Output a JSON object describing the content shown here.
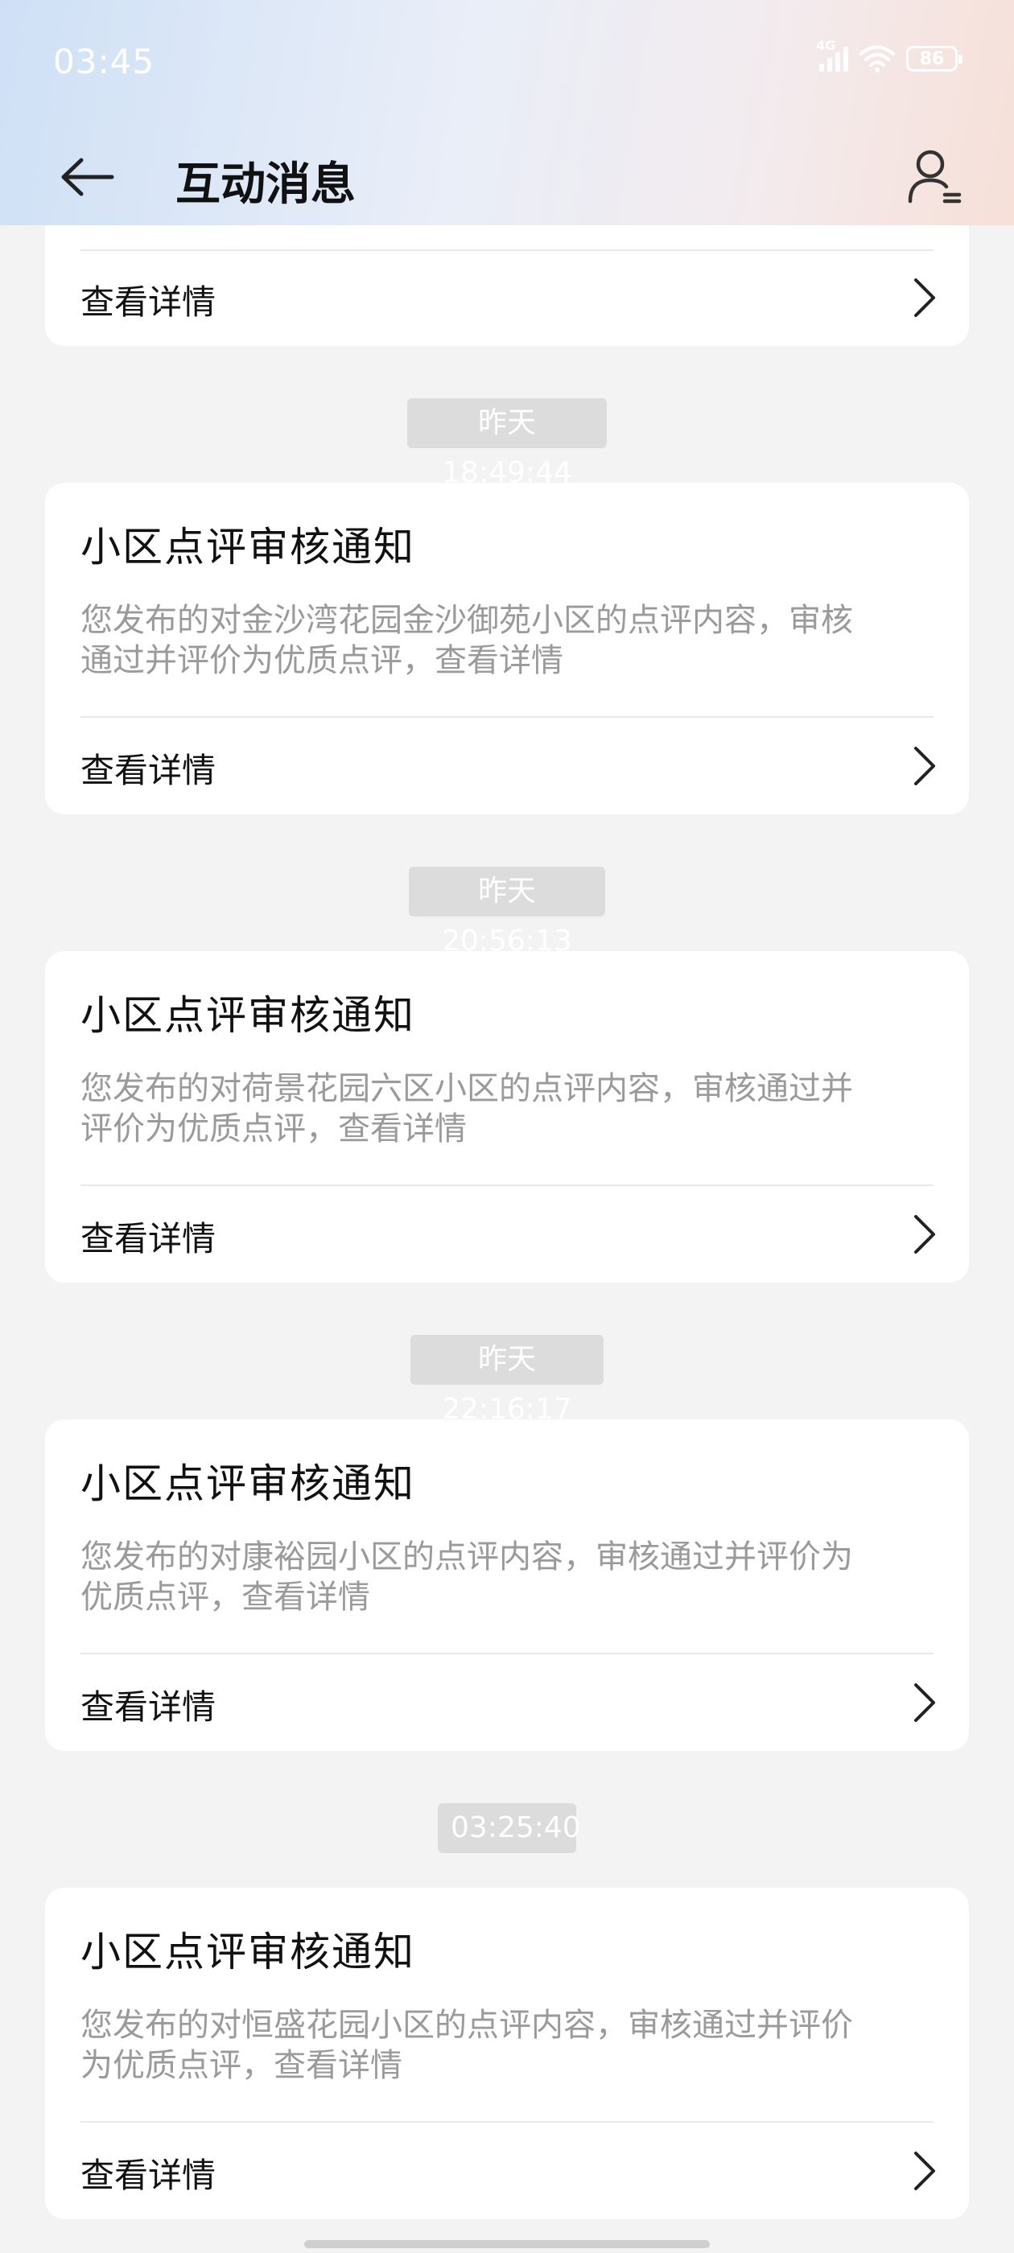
{
  "status_bar": {
    "time": "03:45",
    "network": "4G",
    "battery": "86"
  },
  "header": {
    "title": "互动消息"
  },
  "partial_card": {
    "detail_label": "查看详情"
  },
  "messages": [
    {
      "timestamp": "昨天 18:49:44",
      "title": "小区点评审核通知",
      "desc_line1": "您发布的对金沙湾花园金沙御苑小区的点评内容，审核",
      "desc_line2": "通过并评价为优质点评，查看详情",
      "detail_label": "查看详情"
    },
    {
      "timestamp": "昨天 20:56:13",
      "title": "小区点评审核通知",
      "desc_line1": "您发布的对荷景花园六区小区的点评内容，审核通过并",
      "desc_line2": "评价为优质点评，查看详情",
      "detail_label": "查看详情"
    },
    {
      "timestamp": "昨天 22:16:17",
      "title": "小区点评审核通知",
      "desc_line1": "您发布的对康裕园小区的点评内容，审核通过并评价为",
      "desc_line2": "优质点评，查看详情",
      "detail_label": "查看详情"
    },
    {
      "timestamp": "03:25:40",
      "title": "小区点评审核通知",
      "desc_line1": "您发布的对恒盛花园小区的点评内容，审核通过并评价",
      "desc_line2": "为优质点评，查看详情",
      "detail_label": "查看详情"
    }
  ],
  "icons": {
    "back": "back-arrow-icon",
    "profile": "user-list-icon",
    "chevron": "chevron-right-icon"
  }
}
